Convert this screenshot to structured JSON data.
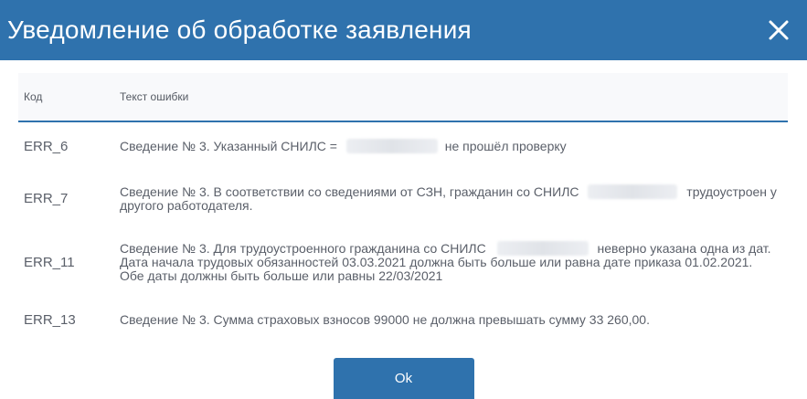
{
  "dialog": {
    "title": "Уведомление об обработке заявления",
    "close_icon": "close-icon",
    "ok_label": "Ok"
  },
  "table": {
    "headers": {
      "code": "Код",
      "text": "Текст ошибки"
    },
    "rows": [
      {
        "code": "ERR_6",
        "text_before": "Сведение № 3. Указанный СНИЛС =",
        "text_after": "не прошёл проверку"
      },
      {
        "code": "ERR_7",
        "text_before": "Сведение № 3. В соответствии со сведениями от СЗН, гражданин со СНИЛС",
        "text_after": "трудоустроен у другого работодателя."
      },
      {
        "code": "ERR_11",
        "text_before": "Сведение № 3. Для трудоустроенного гражданина со СНИЛС",
        "text_after": "неверно указана одна из дат. Дата начала трудовых обязанностей 03.03.2021 должна быть больше или равна дате приказа 01.02.2021. Обе даты должны быть больше или равны 22/03/2021"
      },
      {
        "code": "ERR_13",
        "text": "Сведение № 3. Сумма страховых взносов 99000 не должна превышать сумму 33 260,00."
      }
    ]
  },
  "colors": {
    "accent": "#2f72ad",
    "header_text": "#ffffff",
    "table_text": "#5a5f69"
  }
}
